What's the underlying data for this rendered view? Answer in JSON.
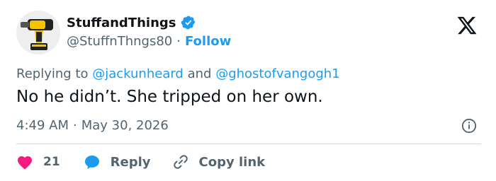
{
  "user": {
    "display_name": "StuffandThings",
    "handle": "@StuffnThngs80",
    "separator": "·",
    "follow_label": "Follow",
    "verified_icon": "verified-badge-icon",
    "accent_color": "#1d9bf0"
  },
  "reply_info": {
    "prefix": "Replying to",
    "mention_1": "@jackunheard",
    "conjunction": "and",
    "mention_2": "@ghostofvangogh1"
  },
  "tweet": {
    "text": "No he didn’t. She tripped on her own.",
    "time": "4:49 AM",
    "separator": "·",
    "date": "May 30, 2026"
  },
  "actions": {
    "like_count": "21",
    "like_color": "#f91880",
    "reply_label": "Reply",
    "copy_link_label": "Copy link"
  }
}
